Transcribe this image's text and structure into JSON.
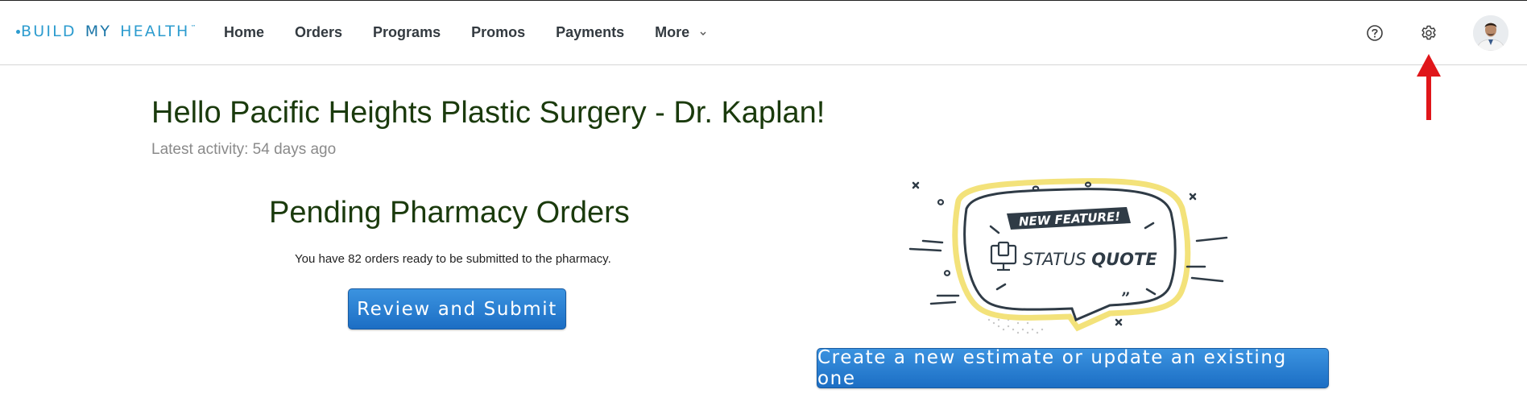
{
  "brand": {
    "part1": "BUILD",
    "part2": "MY",
    "part3": "HEALTH",
    "tm": "™"
  },
  "nav": [
    {
      "label": "Home"
    },
    {
      "label": "Orders"
    },
    {
      "label": "Programs"
    },
    {
      "label": "Promos"
    },
    {
      "label": "Payments"
    },
    {
      "label": "More"
    }
  ],
  "header_icons": [
    "help-icon",
    "gear-icon",
    "avatar"
  ],
  "annotation": {
    "arrow_color": "#e0161a",
    "points_to": "gear-icon"
  },
  "greeting": "Hello Pacific Heights Plastic Surgery - Dr. Kaplan!",
  "latest_activity": "Latest activity: 54 days ago",
  "pending": {
    "title": "Pending Pharmacy Orders",
    "text": "You have 82 orders ready to be submitted to the pharmacy.",
    "button_label": "Review and Submit"
  },
  "feature": {
    "badge": "NEW FEATURE!",
    "name_part1": "STATUS ",
    "name_part2": "QUOTE",
    "button_label": "Create a new estimate or update an existing one"
  },
  "colors": {
    "brand": "#2d9ccf",
    "heading": "#1a3a0c",
    "button": "#1f74c9",
    "accent_yellow": "#f3e27a"
  }
}
